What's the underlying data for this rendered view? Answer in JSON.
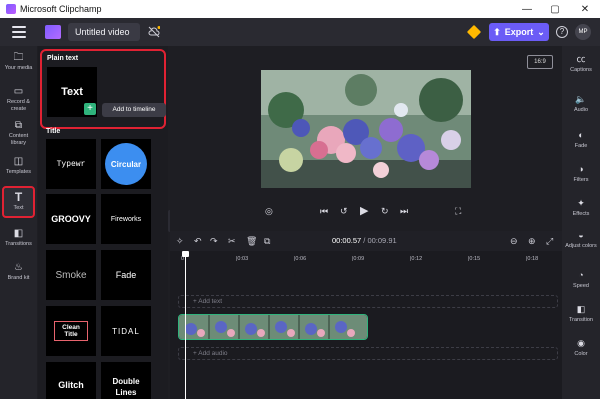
{
  "window": {
    "title": "Microsoft Clipchamp",
    "minimize": "—",
    "maximize": "▢",
    "close": "✕"
  },
  "topbar": {
    "project_title": "Untitled video",
    "export_label": "Export",
    "export_arrow": "⬆",
    "export_caret": "⌄",
    "help": "?",
    "avatar": "MP"
  },
  "leftnav": {
    "items": [
      {
        "icon": "folder-icon",
        "label": "Your media"
      },
      {
        "icon": "camera-icon",
        "label": "Record & create"
      },
      {
        "icon": "library-icon",
        "label": "Content library"
      },
      {
        "icon": "templates-icon",
        "label": "Templates"
      },
      {
        "icon": "text-icon",
        "label": "Text"
      },
      {
        "icon": "transitions-icon",
        "label": "Transitions"
      },
      {
        "icon": "brand-kit-icon",
        "label": "Brand kit"
      }
    ],
    "active": "Text"
  },
  "panel": {
    "plain_text_heading": "Plain text",
    "plain_text_thumb": "Text",
    "add_to_timeline": "Add to timeline",
    "title_heading": "Title",
    "tiles": [
      "Typewr",
      "Circular",
      "GROOVY",
      "Fireworks",
      "Smoke",
      "Fade",
      "Clean Title",
      "TIDAL",
      "Glitch",
      "Double Lines"
    ]
  },
  "stage": {
    "aspect_ratio": "16:9"
  },
  "timeline": {
    "current_time": "00:00.57",
    "total_time": "/ 00:09.91",
    "ruler": [
      "0",
      "|0:03",
      "|0:06",
      "|0:09",
      "|0:12",
      "|0:15",
      "|0:18"
    ],
    "add_text": "+ Add text",
    "add_audio": "+ Add audio"
  },
  "rightnav": {
    "items": [
      {
        "icon": "captions-icon",
        "label": "Captions"
      },
      {
        "icon": "audio-icon",
        "label": "Audio"
      },
      {
        "icon": "fade-icon",
        "label": "Fade"
      },
      {
        "icon": "filters-icon",
        "label": "Filters"
      },
      {
        "icon": "effects-icon",
        "label": "Effects"
      },
      {
        "icon": "adjust-colors-icon",
        "label": "Adjust colors"
      },
      {
        "icon": "speed-icon",
        "label": "Speed"
      },
      {
        "icon": "transition-icon",
        "label": "Transition"
      },
      {
        "icon": "color-icon",
        "label": "Color"
      }
    ]
  },
  "colors": {
    "accent": "#6b5cf6",
    "highlight": "#e02233",
    "clip_border": "#2fb37c"
  }
}
